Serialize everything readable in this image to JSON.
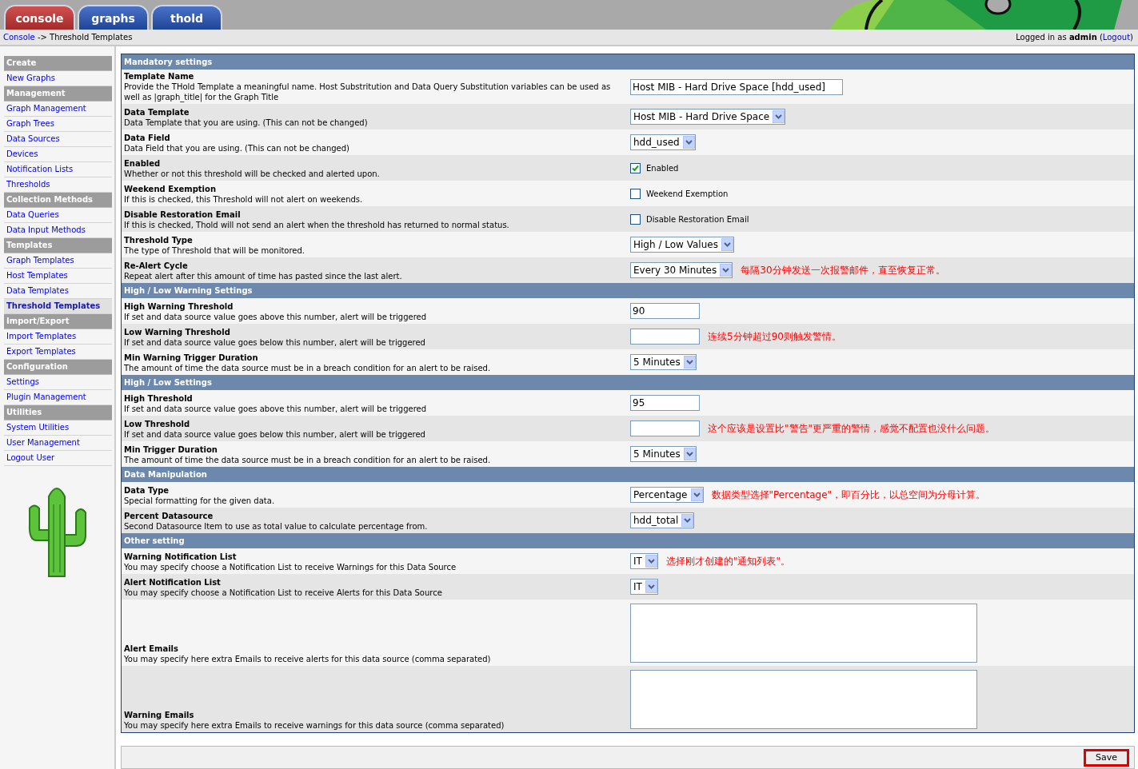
{
  "tabs": [
    {
      "label": "console",
      "selected": true
    },
    {
      "label": "graphs",
      "selected": false
    },
    {
      "label": "thold",
      "selected": false
    }
  ],
  "breadcrumb": {
    "link": "Console",
    "separator": "->",
    "current": "Threshold Templates"
  },
  "login": {
    "prefix": "Logged in as",
    "user": "admin",
    "open": "(",
    "logout": "Logout",
    "close": ")"
  },
  "sidebar": [
    {
      "kind": "header",
      "label": "Create"
    },
    {
      "kind": "link",
      "label": "New Graphs",
      "selected": false
    },
    {
      "kind": "header",
      "label": "Management"
    },
    {
      "kind": "link",
      "label": "Graph Management",
      "selected": false
    },
    {
      "kind": "link",
      "label": "Graph Trees",
      "selected": false
    },
    {
      "kind": "link",
      "label": "Data Sources",
      "selected": false
    },
    {
      "kind": "link",
      "label": "Devices",
      "selected": false
    },
    {
      "kind": "link",
      "label": "Notification Lists",
      "selected": false
    },
    {
      "kind": "link",
      "label": "Thresholds",
      "selected": false
    },
    {
      "kind": "header",
      "label": "Collection Methods"
    },
    {
      "kind": "link",
      "label": "Data Queries",
      "selected": false
    },
    {
      "kind": "link",
      "label": "Data Input Methods",
      "selected": false
    },
    {
      "kind": "header",
      "label": "Templates"
    },
    {
      "kind": "link",
      "label": "Graph Templates",
      "selected": false
    },
    {
      "kind": "link",
      "label": "Host Templates",
      "selected": false
    },
    {
      "kind": "link",
      "label": "Data Templates",
      "selected": false
    },
    {
      "kind": "link",
      "label": "Threshold Templates",
      "selected": true
    },
    {
      "kind": "header",
      "label": "Import/Export"
    },
    {
      "kind": "link",
      "label": "Import Templates",
      "selected": false
    },
    {
      "kind": "link",
      "label": "Export Templates",
      "selected": false
    },
    {
      "kind": "header",
      "label": "Configuration"
    },
    {
      "kind": "link",
      "label": "Settings",
      "selected": false
    },
    {
      "kind": "link",
      "label": "Plugin Management",
      "selected": false
    },
    {
      "kind": "header",
      "label": "Utilities"
    },
    {
      "kind": "link",
      "label": "System Utilities",
      "selected": false
    },
    {
      "kind": "link",
      "label": "User Management",
      "selected": false
    },
    {
      "kind": "link",
      "label": "Logout User",
      "selected": false
    }
  ],
  "sections": [
    {
      "title": "Mandatory settings",
      "rows": [
        {
          "title": "Template Name",
          "description": "Provide the THold Template a meaningful name. Host Substritution and Data Query Substitution variables can be used as well as |graph_title| for the Graph Title",
          "control": {
            "kind": "longtext",
            "value": "Host MIB - Hard Drive Space [hdd_used]"
          }
        },
        {
          "title": "Data Template",
          "description": "Data Template that you are using. (This can not be changed)",
          "control": {
            "kind": "select",
            "value": "Host MIB - Hard Drive Space"
          }
        },
        {
          "title": "Data Field",
          "description": "Data Field that you are using. (This can not be changed)",
          "control": {
            "kind": "select",
            "value": "hdd_used"
          }
        },
        {
          "title": "Enabled",
          "description": "Whether or not this threshold will be checked and alerted upon.",
          "control": {
            "kind": "checkbox",
            "checked": true,
            "label": "Enabled"
          }
        },
        {
          "title": "Weekend Exemption",
          "description": "If this is checked, this Threshold will not alert on weekends.",
          "control": {
            "kind": "checkbox",
            "checked": false,
            "label": "Weekend Exemption"
          }
        },
        {
          "title": "Disable Restoration Email",
          "description": "If this is checked, Thold will not send an alert when the threshold has returned to normal status.",
          "control": {
            "kind": "checkbox",
            "checked": false,
            "label": "Disable Restoration Email"
          }
        },
        {
          "title": "Threshold Type",
          "description": "The type of Threshold that will be monitored.",
          "control": {
            "kind": "select",
            "value": "High / Low Values"
          }
        },
        {
          "title": "Re-Alert Cycle",
          "description": "Repeat alert after this amount of time has pasted since the last alert.",
          "control": {
            "kind": "select",
            "value": "Every 30 Minutes"
          },
          "note": "每隔30分钟发送一次报警邮件，直至恢复正常。"
        }
      ]
    },
    {
      "title": "High / Low Warning Settings",
      "rows": [
        {
          "title": "High Warning Threshold",
          "description": "If set and data source value goes above this number, alert will be triggered",
          "control": {
            "kind": "text",
            "value": "90"
          }
        },
        {
          "title": "Low Warning Threshold",
          "description": "If set and data source value goes below this number, alert will be triggered",
          "control": {
            "kind": "text"
          },
          "note": "连续5分钟超过90则触发警情。"
        },
        {
          "title": "Min Warning Trigger Duration",
          "description": "The amount of time the data source must be in a breach condition for an alert to be raised.",
          "control": {
            "kind": "select",
            "value": "5 Minutes"
          }
        }
      ]
    },
    {
      "title": "High / Low Settings",
      "rows": [
        {
          "title": "High Threshold",
          "description": "If set and data source value goes above this number, alert will be triggered",
          "control": {
            "kind": "text",
            "value": "95"
          }
        },
        {
          "title": "Low Threshold",
          "description": "If set and data source value goes below this number, alert will be triggered",
          "control": {
            "kind": "text"
          },
          "note": "这个应该是设置比\"警告\"更严重的警情，感觉不配置也没什么问题。"
        },
        {
          "title": "Min Trigger Duration",
          "description": "The amount of time the data source must be in a breach condition for an alert to be raised.",
          "control": {
            "kind": "select",
            "value": "5 Minutes"
          }
        }
      ]
    },
    {
      "title": "Data Manipulation",
      "rows": [
        {
          "title": "Data Type",
          "description": "Special formatting for the given data.",
          "control": {
            "kind": "select",
            "value": "Percentage"
          },
          "note": "数据类型选择\"Percentage\"，即百分比，以总空间为分母计算。"
        },
        {
          "title": "Percent Datasource",
          "description": "Second Datasource Item to use as total value to calculate percentage from.",
          "control": {
            "kind": "select",
            "value": "hdd_total"
          }
        }
      ]
    },
    {
      "title": "Other setting",
      "rows": [
        {
          "title": "Warning Notification List",
          "description": "You may specify choose a Notification List to receive Warnings for this Data Source",
          "control": {
            "kind": "select",
            "value": "IT"
          },
          "note": "选择刚才创建的\"通知列表\"。"
        },
        {
          "title": "Alert Notification List",
          "description": "You may specify choose a Notification List to receive Alerts for this Data Source",
          "control": {
            "kind": "select",
            "value": "IT"
          }
        },
        {
          "title": "Alert Emails",
          "description": "You may specify here extra Emails to receive alerts for this data source (comma separated)",
          "control": {
            "kind": "textarea"
          }
        },
        {
          "title": "Warning Emails",
          "description": "You may specify here extra Emails to receive warnings for this data source (comma separated)",
          "control": {
            "kind": "textarea"
          }
        }
      ]
    }
  ],
  "save_button": {
    "label": "Save",
    "highlighted": true
  }
}
